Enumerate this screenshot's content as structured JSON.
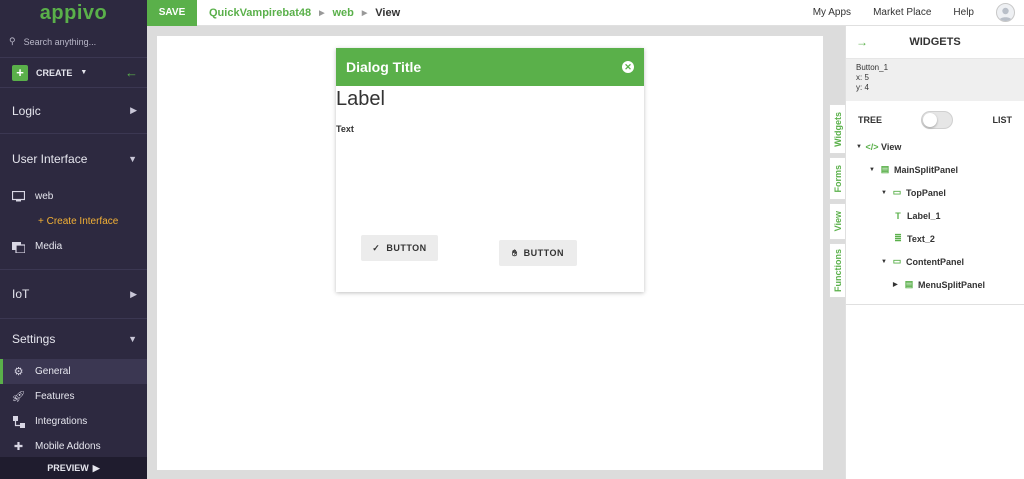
{
  "sidebar": {
    "logo": "appivo",
    "search_placeholder": "Search anything...",
    "create_label": "CREATE",
    "sections": {
      "logic": "Logic",
      "ui": "User Interface",
      "iot": "IoT",
      "settings": "Settings"
    },
    "ui_items": {
      "web": "web",
      "create_interface": "+ Create Interface",
      "media": "Media"
    },
    "settings_items": {
      "general": "General",
      "features": "Features",
      "integrations": "Integrations",
      "mobile_addons": "Mobile Addons"
    },
    "preview_label": "PREVIEW"
  },
  "topbar": {
    "save_label": "SAVE",
    "breadcrumb": [
      "QuickVampirebat48",
      "web",
      "View"
    ],
    "links": [
      "My Apps",
      "Market Place",
      "Help"
    ]
  },
  "canvas": {
    "dialog_title": "Dialog Title",
    "label": "Label",
    "text": "Text",
    "button1": "BUTTON",
    "button2": "BUTTON"
  },
  "vtabs": [
    "Widgets",
    "Forms",
    "View",
    "Functions"
  ],
  "widgets_panel": {
    "title": "WIDGETS",
    "selected_name": "Button_1",
    "x_label": "x:",
    "x_value": "5",
    "y_label": "y:",
    "y_value": "4",
    "tree_label": "TREE",
    "list_label": "LIST",
    "tree": [
      "View",
      "MainSplitPanel",
      "TopPanel",
      "Label_1",
      "Text_2",
      "ContentPanel",
      "MenuSplitPanel"
    ]
  },
  "colors": {
    "accent": "#5ab04a",
    "sidebar_bg": "#2d2940",
    "highlight": "#f2b035"
  }
}
